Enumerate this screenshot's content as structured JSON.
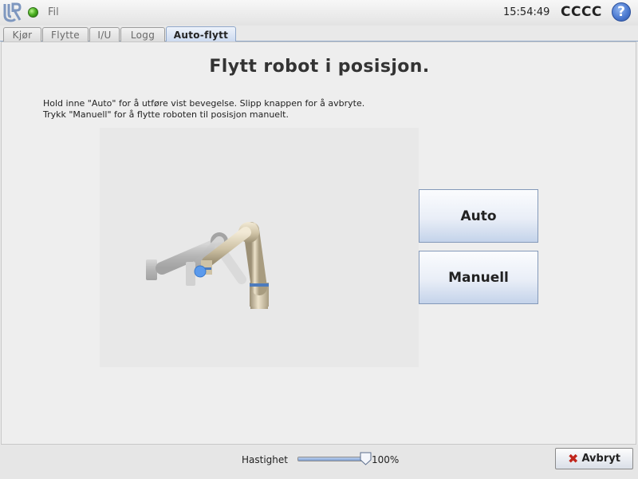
{
  "topbar": {
    "menu_file": "Fil",
    "clock": "15:54:49",
    "robot_name": "CCCC",
    "help_symbol": "?",
    "status_color": "#3fa51c"
  },
  "tabs": [
    {
      "label": "Kjør",
      "active": false
    },
    {
      "label": "Flytte",
      "active": false
    },
    {
      "label": "I/U",
      "active": false
    },
    {
      "label": "Logg",
      "active": false
    },
    {
      "label": "Auto-flytt",
      "active": true
    }
  ],
  "main": {
    "title": "Flytt robot i posisjon.",
    "instruction_line1": "Hold inne \"Auto\" for å utføre vist bevegelse. Slipp knappen for å avbryte.",
    "instruction_line2": "Trykk \"Manuell\" for å flytte roboten til posisjon manuelt.",
    "auto_button": "Auto",
    "manual_button": "Manuell"
  },
  "footer": {
    "speed_label": "Hastighet",
    "speed_value": "100%",
    "speed_fraction": 1.0,
    "cancel_button": "Avbryt",
    "cancel_icon": "close-icon"
  },
  "colors": {
    "accent": "#c9d8ef",
    "target_marker": "#4d8fe8",
    "cancel_icon": "#c0261c"
  }
}
